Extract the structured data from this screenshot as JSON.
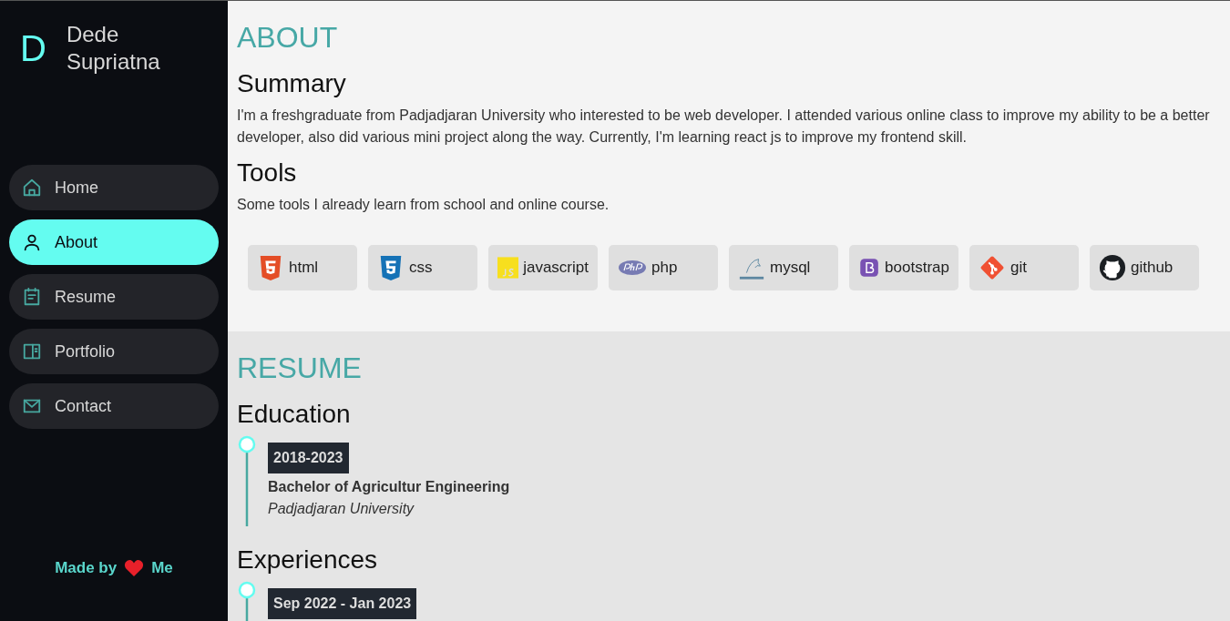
{
  "brand": {
    "initial": "D",
    "name": "Dede Supriatna"
  },
  "nav": [
    {
      "label": "Home",
      "kind": "home",
      "selected": false
    },
    {
      "label": "About",
      "kind": "user",
      "selected": true
    },
    {
      "label": "Resume",
      "kind": "calendar",
      "selected": false
    },
    {
      "label": "Portfolio",
      "kind": "panel",
      "selected": false
    },
    {
      "label": "Contact",
      "kind": "mail",
      "selected": false
    }
  ],
  "footer": {
    "before": "Made by",
    "after": "Me"
  },
  "about": {
    "title": "ABOUT",
    "summary_heading": "Summary",
    "summary": "I'm a freshgraduate from Padjadjaran University who interested to be web developer. I attended various online class to improve my ability to be a better developer, also did various mini project along the way. Currently, I'm learning react js to improve my frontend skill.",
    "tools_heading": "Tools",
    "tools_intro": "Some tools I already learn from school and online course.",
    "tools": [
      {
        "label": "html",
        "kind": "html"
      },
      {
        "label": "css",
        "kind": "css"
      },
      {
        "label": "javascript",
        "kind": "js"
      },
      {
        "label": "php",
        "kind": "php"
      },
      {
        "label": "mysql",
        "kind": "mysql"
      },
      {
        "label": "bootstrap",
        "kind": "bootstrap"
      },
      {
        "label": "git",
        "kind": "git"
      },
      {
        "label": "github",
        "kind": "github"
      }
    ]
  },
  "resume": {
    "title": "RESUME",
    "sections": [
      {
        "heading": "Education",
        "entries": [
          {
            "date": "2018-2023",
            "title": "Bachelor of Agricultur Engineering",
            "place": "Padjadjaran University"
          }
        ]
      },
      {
        "heading": "Experiences",
        "entries": [
          {
            "date": "Sep 2022 - Jan 2023"
          }
        ]
      }
    ]
  }
}
